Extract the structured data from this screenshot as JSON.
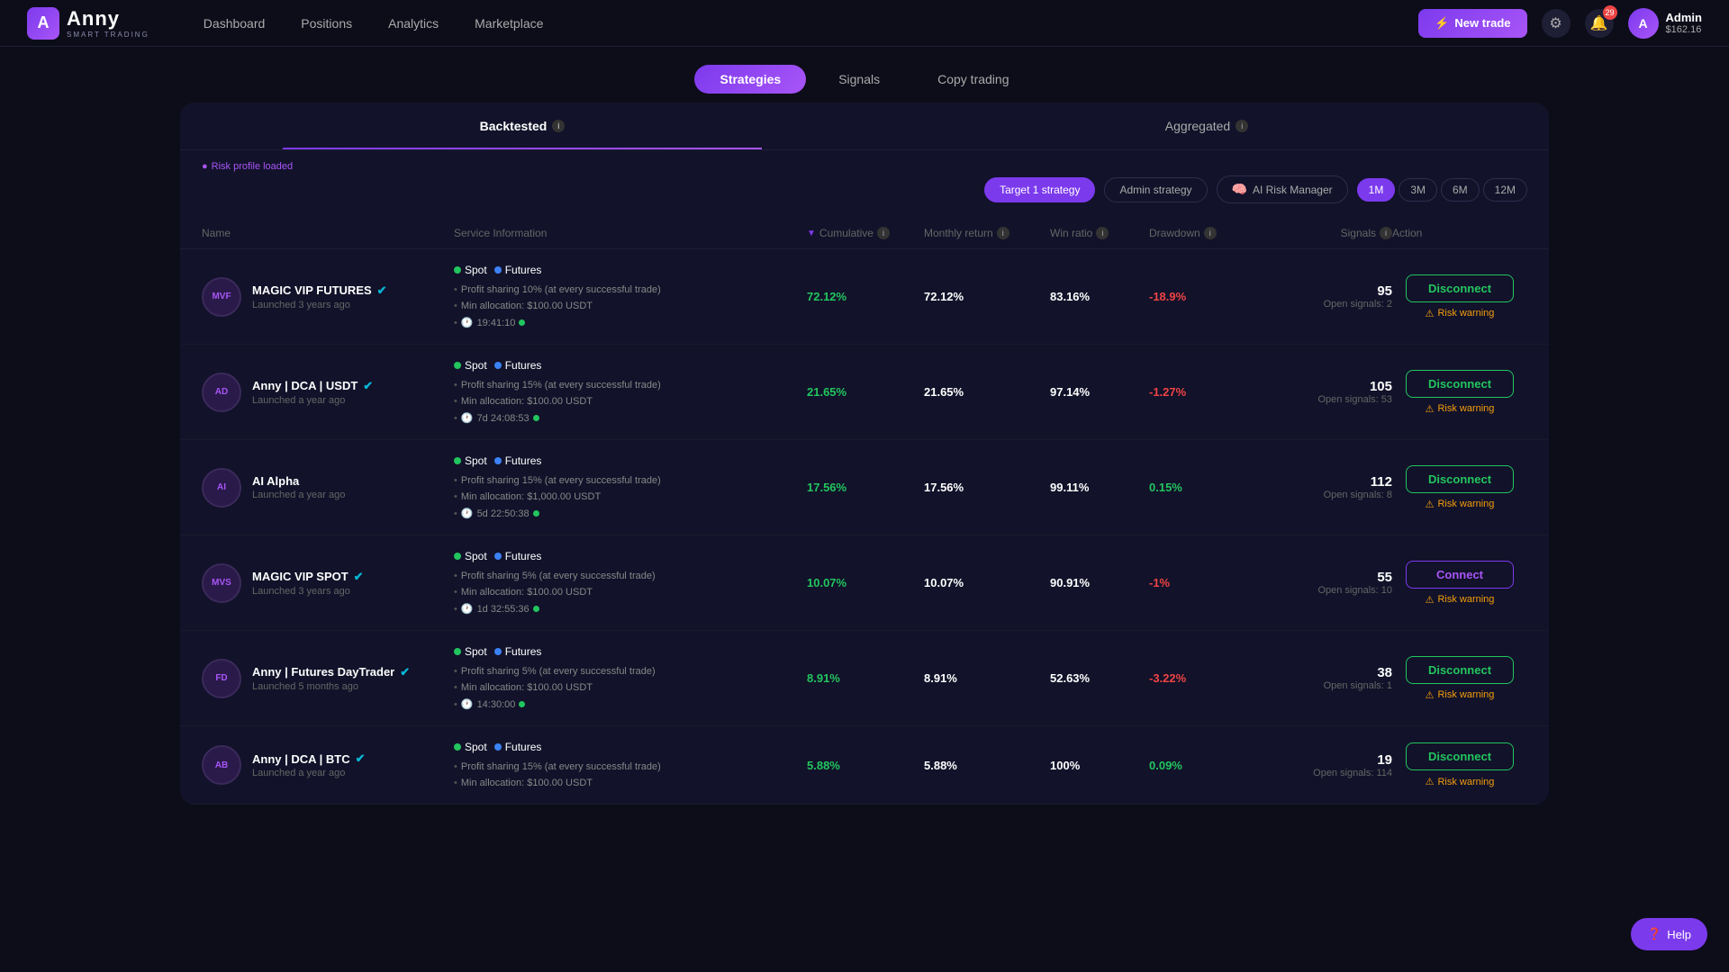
{
  "app": {
    "name": "Anny",
    "subtitle": "SMART TRADING"
  },
  "nav": {
    "items": [
      "Dashboard",
      "Positions",
      "Analytics",
      "Marketplace"
    ]
  },
  "header": {
    "new_trade_label": "New trade",
    "notification_count": "29",
    "user": {
      "name": "Admin",
      "balance": "$162.16"
    }
  },
  "tabs": {
    "items": [
      "Strategies",
      "Signals",
      "Copy trading"
    ],
    "active": "Strategies"
  },
  "inner_tabs": {
    "items": [
      "Backtested",
      "Aggregated"
    ],
    "active": "Backtested"
  },
  "filters": {
    "strategies": [
      "Target 1 strategy",
      "Admin strategy",
      "AI Risk Manager"
    ],
    "active_strategy": "Target 1 strategy",
    "time_periods": [
      "1M",
      "3M",
      "6M",
      "12M"
    ],
    "active_period": "1M",
    "risk_profile": "Risk profile loaded"
  },
  "table": {
    "headers": [
      "Name",
      "Service Information",
      "Cumulative",
      "Monthly return",
      "Win ratio",
      "Drawdown",
      "Signals",
      "Action"
    ],
    "rows": [
      {
        "name": "MAGIC VIP FUTURES",
        "launched": "Launched 3 years ago",
        "verified": true,
        "spot": true,
        "futures": true,
        "profit_sharing": "Profit sharing 10% (at every successful trade)",
        "min_allocation": "Min allocation: $100.00 USDT",
        "time": "19:41:10",
        "cumulative": "72.12%",
        "monthly_return": "72.12%",
        "win_ratio": "83.16%",
        "drawdown": "-18.9%",
        "signals": "95",
        "open_signals": "Open signals: 2",
        "action": "Disconnect",
        "risk_warning": "Risk warning",
        "avatar_text": "MVF"
      },
      {
        "name": "Anny | DCA | USDT",
        "launched": "Launched a year ago",
        "verified": true,
        "spot": true,
        "futures": true,
        "profit_sharing": "Profit sharing 15% (at every successful trade)",
        "min_allocation": "Min allocation: $100.00 USDT",
        "time": "7d 24:08:53",
        "cumulative": "21.65%",
        "monthly_return": "21.65%",
        "win_ratio": "97.14%",
        "drawdown": "-1.27%",
        "signals": "105",
        "open_signals": "Open signals: 53",
        "action": "Disconnect",
        "risk_warning": "Risk warning",
        "avatar_text": "AD"
      },
      {
        "name": "AI Alpha",
        "launched": "Launched a year ago",
        "verified": false,
        "spot": true,
        "futures": true,
        "profit_sharing": "Profit sharing 15% (at every successful trade)",
        "min_allocation": "Min allocation: $1,000.00 USDT",
        "time": "5d 22:50:38",
        "cumulative": "17.56%",
        "monthly_return": "17.56%",
        "win_ratio": "99.11%",
        "drawdown": "0.15%",
        "signals": "112",
        "open_signals": "Open signals: 8",
        "action": "Disconnect",
        "risk_warning": "Risk warning",
        "avatar_text": "AI"
      },
      {
        "name": "MAGIC VIP SPOT",
        "launched": "Launched 3 years ago",
        "verified": true,
        "spot": true,
        "futures": true,
        "profit_sharing": "Profit sharing 5% (at every successful trade)",
        "min_allocation": "Min allocation: $100.00 USDT",
        "time": "1d 32:55:36",
        "cumulative": "10.07%",
        "monthly_return": "10.07%",
        "win_ratio": "90.91%",
        "drawdown": "-1%",
        "signals": "55",
        "open_signals": "Open signals: 10",
        "action": "Connect",
        "risk_warning": "Risk warning",
        "avatar_text": "MVS"
      },
      {
        "name": "Anny | Futures DayTrader",
        "launched": "Launched 5 months ago",
        "verified": true,
        "spot": true,
        "futures": true,
        "profit_sharing": "Profit sharing 5% (at every successful trade)",
        "min_allocation": "Min allocation: $100.00 USDT",
        "time": "14:30:00",
        "cumulative": "8.91%",
        "monthly_return": "8.91%",
        "win_ratio": "52.63%",
        "drawdown": "-3.22%",
        "signals": "38",
        "open_signals": "Open signals: 1",
        "action": "Disconnect",
        "risk_warning": "Risk warning",
        "avatar_text": "FD"
      },
      {
        "name": "Anny | DCA | BTC",
        "launched": "Launched a year ago",
        "verified": true,
        "spot": true,
        "futures": true,
        "profit_sharing": "Profit sharing 15% (at every successful trade)",
        "min_allocation": "Min allocation: $100.00 USDT",
        "time": "",
        "cumulative": "5.88%",
        "monthly_return": "5.88%",
        "win_ratio": "100%",
        "drawdown": "0.09%",
        "signals": "19",
        "open_signals": "Open signals: 114",
        "action": "Disconnect",
        "risk_warning": "Risk warning",
        "avatar_text": "AB"
      }
    ]
  },
  "help": {
    "label": "Help"
  }
}
